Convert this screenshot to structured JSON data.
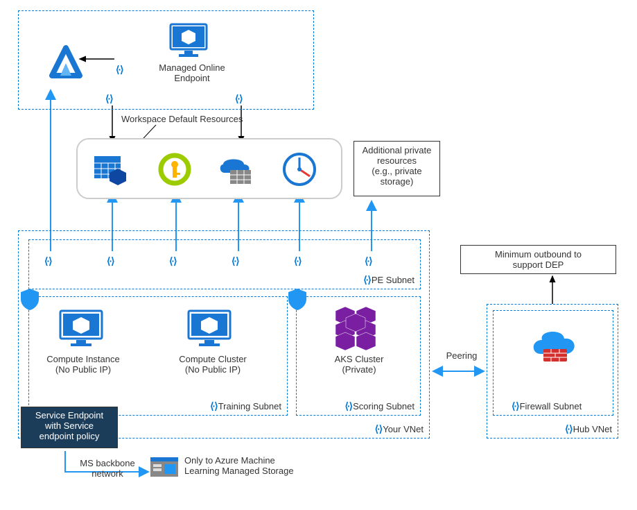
{
  "moe": {
    "title1": "Managed Online",
    "title2": "Endpoint"
  },
  "wdr": {
    "label": "Workspace Default Resources"
  },
  "addl": {
    "l1": "Additional private",
    "l2": "resources",
    "l3": "(e.g., private",
    "l4": "storage)"
  },
  "pe_subnet": "PE Subnet",
  "compute_instance": {
    "l1": "Compute Instance",
    "l2": "(No Public IP)"
  },
  "compute_cluster": {
    "l1": "Compute Cluster",
    "l2": "(No Public IP)"
  },
  "training_subnet": "Training Subnet",
  "aks": {
    "l1": "AKS Cluster",
    "l2": "(Private)"
  },
  "scoring_subnet": "Scoring Subnet",
  "your_vnet": "Your VNet",
  "peering": "Peering",
  "min_outbound": {
    "l1": "Minimum outbound to",
    "l2": "support DEP"
  },
  "firewall_subnet": "Firewall Subnet",
  "hub_vnet": "Hub VNet",
  "svc_endpoint": {
    "l1": "Service Endpoint",
    "l2": "with  Service",
    "l3": "endpoint policy"
  },
  "ms_backbone": {
    "l1": "MS backbone",
    "l2": "network"
  },
  "only_to": {
    "l1": "Only to Azure Machine",
    "l2": "Learning Managed Storage"
  }
}
